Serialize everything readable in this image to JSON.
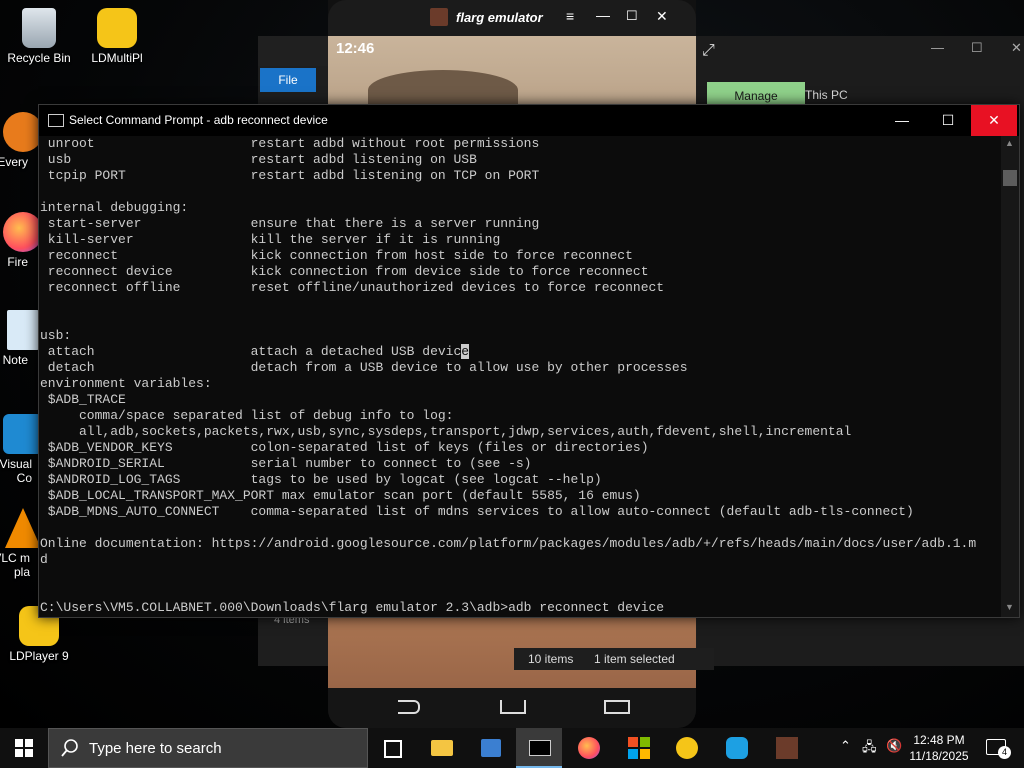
{
  "desktop": {
    "icons": [
      {
        "label": "Recycle Bin",
        "icon": "recycle-bin-icon"
      },
      {
        "label": "LDMultiPl",
        "icon": "ldmultiplayer-icon"
      },
      {
        "label": "Every",
        "icon": "everything-icon"
      },
      {
        "label": "Fire",
        "icon": "firefox-icon"
      },
      {
        "label": "Note",
        "icon": "notepad-icon"
      },
      {
        "label": "Visual Co",
        "icon": "vscode-icon"
      },
      {
        "label": "VLC m pla",
        "icon": "vlc-icon"
      },
      {
        "label": "LDPlayer 9",
        "icon": "ldplayer-icon"
      }
    ]
  },
  "emulator": {
    "title": "flarg emulator",
    "status_time": "12:46"
  },
  "explorer": {
    "file_tab": "File",
    "manage_tab": "Manage",
    "this_pc": "This PC",
    "items_left": "4 items",
    "items_count": "10 items",
    "selected": "1 item selected"
  },
  "cmd": {
    "title": "Select Command Prompt - adb  reconnect device",
    "lines_before_cursor": " unroot                    restart adbd without root permissions\n usb                       restart adbd listening on USB\n tcpip PORT                restart adbd listening on TCP on PORT\n\ninternal debugging:\n start-server              ensure that there is a server running\n kill-server               kill the server if it is running\n reconnect                 kick connection from host side to force reconnect\n reconnect device          kick connection from device side to force reconnect\n reconnect offline         reset offline/unauthorized devices to force reconnect\n\n\nusb:\n attach                    attach a detached USB devic",
    "cursor_char": "e",
    "lines_after_cursor": "\n detach                    detach from a USB device to allow use by other processes\nenvironment variables:\n $ADB_TRACE\n     comma/space separated list of debug info to log:\n     all,adb,sockets,packets,rwx,usb,sync,sysdeps,transport,jdwp,services,auth,fdevent,shell,incremental\n $ADB_VENDOR_KEYS          colon-separated list of keys (files or directories)\n $ANDROID_SERIAL           serial number to connect to (see -s)\n $ANDROID_LOG_TAGS         tags to be used by logcat (see logcat --help)\n $ADB_LOCAL_TRANSPORT_MAX_PORT max emulator scan port (default 5585, 16 emus)\n $ADB_MDNS_AUTO_CONNECT    comma-separated list of mdns services to allow auto-connect (default adb-tls-connect)\n\nOnline documentation: https://android.googlesource.com/platform/packages/modules/adb/+/refs/heads/main/docs/user/adb.1.m\nd\n\n\nC:\\Users\\VM5.COLLABNET.000\\Downloads\\flarg emulator 2.3\\adb>adb reconnect device",
    "minimize": "—",
    "maximize": "☐",
    "close": "✕"
  },
  "taskbar": {
    "search_placeholder": "Type here to search",
    "time": "12:48 PM",
    "date": "11/18/2025",
    "notification_count": "4",
    "apps": [
      "task-view-icon",
      "file-explorer-icon",
      "network-app-icon",
      "command-prompt-icon",
      "firefox-icon",
      "microsoft-store-icon",
      "ldplayer-icon",
      "ldmultiplayer-icon",
      "flarg-emulator-icon"
    ]
  },
  "colors": {
    "close_red": "#e81123",
    "manage_green": "#8fd18a",
    "taskbar": "#101010",
    "console_text": "#cccccc"
  }
}
